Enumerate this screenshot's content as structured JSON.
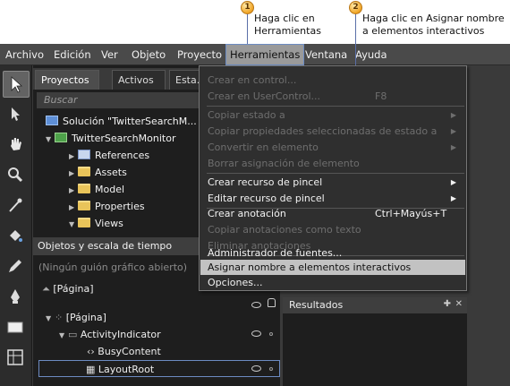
{
  "callouts": [
    {
      "number": "1",
      "line1": "Haga clic en",
      "line2": "Herramientas"
    },
    {
      "number": "2",
      "line1": "Haga clic en Asignar nombre",
      "line2": "a elementos interactivos"
    }
  ],
  "menubar": {
    "items": [
      "Archivo",
      "Edición",
      "Ver",
      "Objeto",
      "Proyecto",
      "Herramientas",
      "Ventana",
      "Ayuda"
    ]
  },
  "project_panel": {
    "tabs": [
      "Proyectos",
      "Activos",
      "Esta..."
    ],
    "tab_close": "×",
    "search_placeholder": "Buscar",
    "tree": {
      "solution": "Solución \"TwitterSearchM...",
      "project": "TwitterSearchMonitor",
      "items": [
        "References",
        "Assets",
        "Model",
        "Properties",
        "Views"
      ]
    }
  },
  "objects_panel": {
    "title": "Objetos y escala de tiempo",
    "storyboard": "(Ningún guión gráfico abierto)",
    "page_label": "[Página]",
    "tree_page": "[Página]",
    "items": [
      "ActivityIndicator",
      "BusyContent",
      "LayoutRoot"
    ]
  },
  "results_panel": {
    "title": "Resultados"
  },
  "dropdown": {
    "items": [
      {
        "label": "Crear en control...",
        "shortcut": "",
        "arrow": false,
        "enabled": false
      },
      {
        "label": "Crear en UserControl...",
        "shortcut": "F8",
        "arrow": false,
        "enabled": false
      },
      {
        "label": "Copiar estado a",
        "shortcut": "",
        "arrow": true,
        "enabled": false
      },
      {
        "label": "Copiar propiedades seleccionadas de estado a",
        "shortcut": "",
        "arrow": true,
        "enabled": false
      },
      {
        "label": "Convertir en elemento",
        "shortcut": "",
        "arrow": true,
        "enabled": false
      },
      {
        "label": "Borrar asignación de elemento",
        "shortcut": "",
        "arrow": false,
        "enabled": false
      },
      {
        "label": "Crear recurso de pincel",
        "shortcut": "",
        "arrow": true,
        "enabled": true
      },
      {
        "label": "Editar recurso de pincel",
        "shortcut": "",
        "arrow": true,
        "enabled": true
      },
      {
        "label": "Crear anotación",
        "shortcut": "Ctrl+Mayús+T",
        "arrow": false,
        "enabled": true
      },
      {
        "label": "Copiar anotaciones como texto",
        "shortcut": "",
        "arrow": false,
        "enabled": false
      },
      {
        "label": "Eliminar anotaciones",
        "shortcut": "",
        "arrow": false,
        "enabled": false
      },
      {
        "label": "Administrador de fuentes...",
        "shortcut": "",
        "arrow": false,
        "enabled": true
      },
      {
        "label": "Asignar nombre a elementos interactivos",
        "shortcut": "",
        "arrow": false,
        "enabled": true
      },
      {
        "label": "Opciones...",
        "shortcut": "",
        "arrow": false,
        "enabled": true
      }
    ]
  },
  "colors": {
    "callout_line": "#5a6fa8",
    "callout_badge": "#f0a526",
    "menu_background": "#2f2f2f",
    "highlight": "#c2c2c2"
  }
}
